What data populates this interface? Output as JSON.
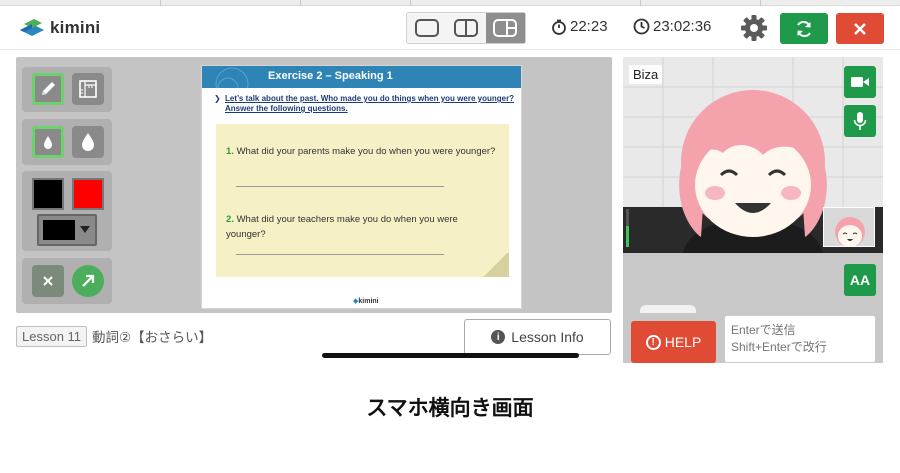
{
  "app": {
    "logo_text": "kimini"
  },
  "header": {
    "layouts": [
      "single-layout",
      "split-layout",
      "panel-layout"
    ],
    "active_layout": "panel-layout",
    "timer_elapsed": "22:23",
    "timer_clock": "23:02:36"
  },
  "colors": {
    "brand_green": "#1f9a4a",
    "danger_red": "#e04b35",
    "slide_blue": "#2e84b5",
    "selected_outline": "#6dd16d"
  },
  "tools": {
    "pen_icon": "pencil-icon",
    "ruler_icon": "ruler-icon",
    "ink_small_icon": "ink-drop-small-icon",
    "ink_large_icon": "ink-drop-large-icon",
    "color_black": "#000000",
    "color_red": "#ff0000",
    "selected_color": "#000000",
    "close_icon": "x-icon",
    "arrow_icon": "arrow-up-right-icon"
  },
  "slide": {
    "title": "Exercise 2 – Speaking 1",
    "instruction": "Let’s talk about the past. Who made you do things when you were younger? Answer the following questions.",
    "q1_number": "1.",
    "q1_text": "What did your parents make you do when you were younger?",
    "q2_number": "2.",
    "q2_text": "What did your teachers make you do when you were younger?",
    "brand": "kimini"
  },
  "lesson": {
    "badge": "Lesson 11",
    "title": "動詞②【おさらい】",
    "info_button": "Lesson Info"
  },
  "video": {
    "participant_name": "Biza",
    "mic_level": 0.55
  },
  "chat": {
    "aa_label": "AA",
    "help_label": "HELP",
    "input_placeholder": "Enterで送信\nShift+Enterで改行"
  },
  "caption": "スマホ横向き画面"
}
